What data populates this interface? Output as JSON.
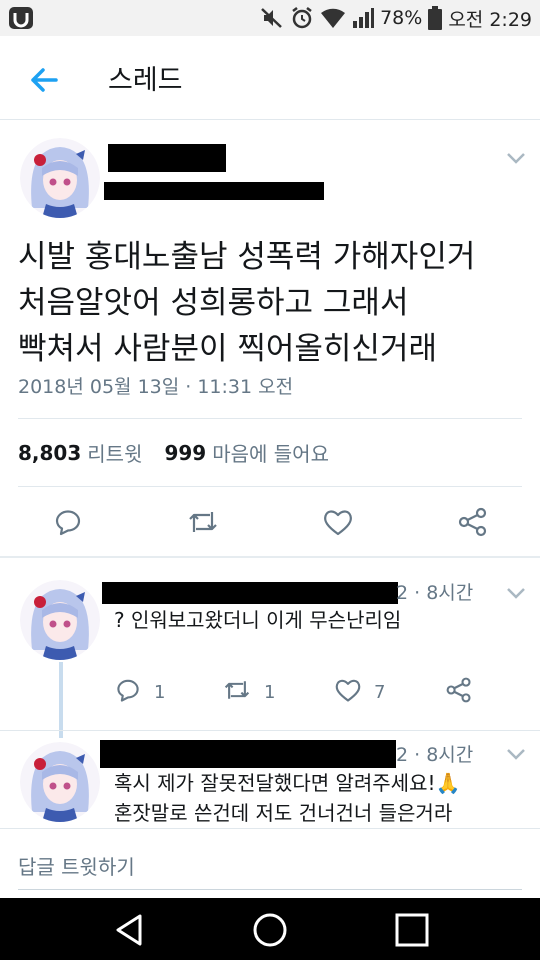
{
  "status_bar": {
    "battery": "78%",
    "time": "오전 2:29"
  },
  "app_bar": {
    "title": "스레드"
  },
  "main_tweet": {
    "text": "시발 홍대노출남 성폭력 가해자인거\n처음알앗어 성희롱하고 그래서\n빡쳐서 사람분이 찍어올히신거래",
    "timestamp": "2018년 05월 13일 · 11:31 오전",
    "retweet_count": "8,803",
    "retweet_label": "리트윗",
    "like_count": "999",
    "like_label": "마음에 들어요"
  },
  "replies": [
    {
      "time": "2 · 8시간",
      "text": "? 인워보고왔더니 이게 무슨난리임",
      "retweet_count": "1",
      "reply_count": "1",
      "like_count": "7"
    },
    {
      "time": "2 · 8시간",
      "text": "혹시 제가 잘못전달했다면 알려주세요!🙏\n혼잣말로 쓴건데 저도 건너건너 들은거라"
    }
  ],
  "reply_box": {
    "placeholder": "답글 트윗하기"
  },
  "colors": {
    "accent": "#1da1f2",
    "icon_gray": "#657786",
    "divider": "#e1e8ed",
    "thread_line": "#c8dcee"
  },
  "icons": [
    "app-logo-icon",
    "mute-icon",
    "alarm-icon",
    "wifi-icon",
    "signal-icon",
    "battery-icon",
    "back-arrow-icon",
    "chevron-down-icon",
    "reply-icon",
    "retweet-icon",
    "like-icon",
    "share-icon",
    "nav-back-icon",
    "nav-home-icon",
    "nav-recents-icon"
  ]
}
